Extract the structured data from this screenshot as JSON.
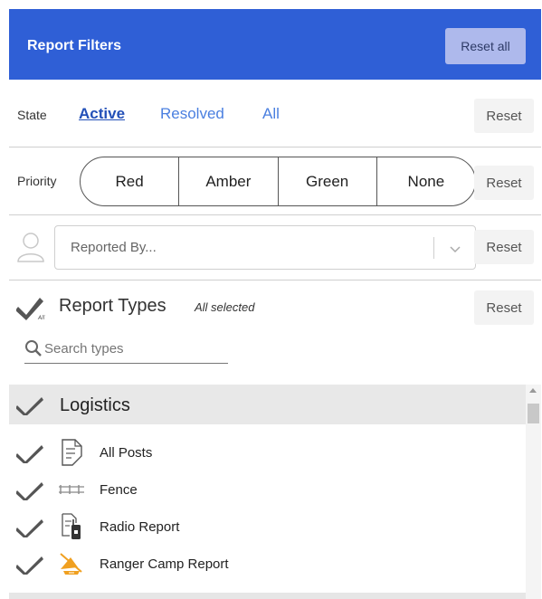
{
  "header": {
    "title": "Report Filters",
    "reset_all_label": "Reset all"
  },
  "state": {
    "label": "State",
    "tabs": [
      {
        "label": "Active"
      },
      {
        "label": "Resolved"
      },
      {
        "label": "All"
      }
    ],
    "selected": "Active",
    "reset_label": "Reset"
  },
  "priority": {
    "label": "Priority",
    "options": [
      {
        "label": "Red"
      },
      {
        "label": "Amber"
      },
      {
        "label": "Green"
      },
      {
        "label": "None"
      }
    ],
    "reset_label": "Reset"
  },
  "reported_by": {
    "placeholder": "Reported By...",
    "reset_label": "Reset"
  },
  "report_types": {
    "title": "Report Types",
    "subtitle": "All selected",
    "reset_label": "Reset",
    "search_placeholder": "Search types"
  },
  "list": {
    "group": {
      "label": "Logistics",
      "icon": "check-icon"
    },
    "items": [
      {
        "label": "All Posts",
        "icon": "document-icon"
      },
      {
        "label": "Fence",
        "icon": "fence-icon"
      },
      {
        "label": "Radio Report",
        "icon": "radio-report-icon"
      },
      {
        "label": "Ranger Camp Report",
        "icon": "ranger-camp-icon"
      }
    ]
  },
  "colors": {
    "header_bg": "#2f5fd6",
    "active_tab": "#2350b8",
    "link": "#4a7fe0",
    "camp_icon": "#f0a020"
  }
}
